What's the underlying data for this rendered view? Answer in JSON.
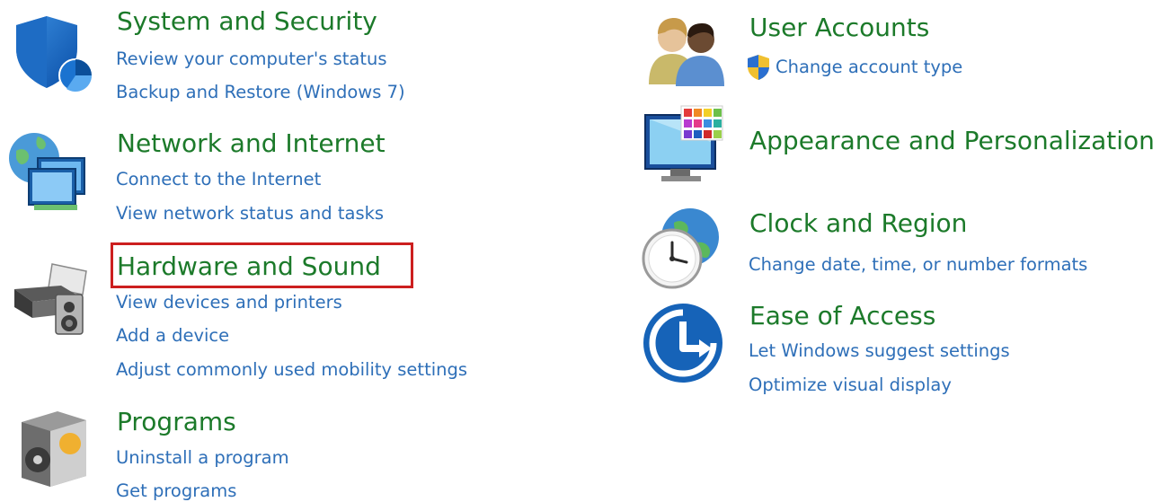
{
  "categories": {
    "system_security": {
      "title": "System and Security",
      "icon": "shield-icon",
      "links": [
        "Review your computer's status",
        "Backup and Restore (Windows 7)"
      ]
    },
    "network_internet": {
      "title": "Network and Internet",
      "icon": "network-globe-icon",
      "links": [
        "Connect to the Internet",
        "View network status and tasks"
      ]
    },
    "hardware_sound": {
      "title": "Hardware and Sound",
      "icon": "printer-speaker-icon",
      "highlighted": true,
      "highlight_color": "#cc1f1f",
      "links": [
        "View devices and printers",
        "Add a device",
        "Adjust commonly used mobility settings"
      ]
    },
    "programs": {
      "title": "Programs",
      "icon": "programs-disc-icon",
      "links": [
        "Uninstall a program",
        "Get programs"
      ]
    },
    "user_accounts": {
      "title": "User Accounts",
      "icon": "users-icon",
      "links": [
        "Change account type"
      ],
      "link_icon": "uac-shield-icon"
    },
    "appearance": {
      "title": "Appearance and Personalization",
      "icon": "monitor-palette-icon",
      "links": []
    },
    "clock_region": {
      "title": "Clock and Region",
      "icon": "clock-globe-icon",
      "links": [
        "Change date, time, or number formats"
      ]
    },
    "ease_access": {
      "title": "Ease of Access",
      "icon": "ease-of-access-icon",
      "links": [
        "Let Windows suggest settings",
        "Optimize visual display"
      ]
    }
  },
  "colors": {
    "title": "#1c7a2a",
    "link": "#2e6fb8",
    "background": "#ffffff"
  }
}
